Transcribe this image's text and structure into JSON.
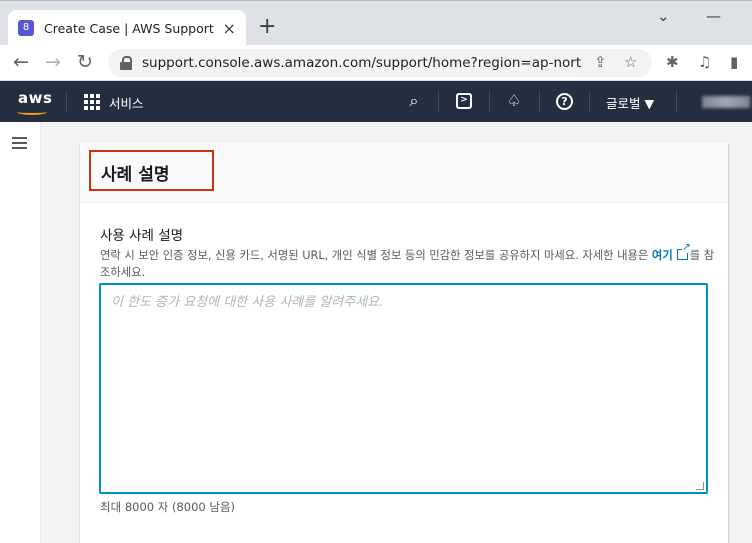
{
  "browser": {
    "tab_title": "Create Case | AWS Support Con",
    "favicon_glyph": "8",
    "url": "support.console.aws.amazon.com/support/home?region=ap-northe..."
  },
  "aws_header": {
    "logo": "aws",
    "services_label": "서비스",
    "region_label": "글로벌 ▼"
  },
  "card": {
    "title": "사례 설명",
    "field_label": "사용 사례 설명",
    "description": "연락 시 보안 인증 정보, 신용 카드, 서명된 URL, 개인 식별 정보 등의 민감한 정보를 공유하지 마세요. 자세한 내용은",
    "link_text": "여기",
    "description_suffix": "를 참조하세요.",
    "placeholder": "이 한도 증가 요청에 대한 사용 사례를 알려주세요.",
    "char_count": "최대 8000 자 (8000 남음)"
  },
  "colors": {
    "aws_navy": "#232f3e",
    "aws_orange": "#ff9900",
    "link_blue": "#0073bb",
    "focus_blue": "#0093c7",
    "highlight_red": "#d13212"
  }
}
